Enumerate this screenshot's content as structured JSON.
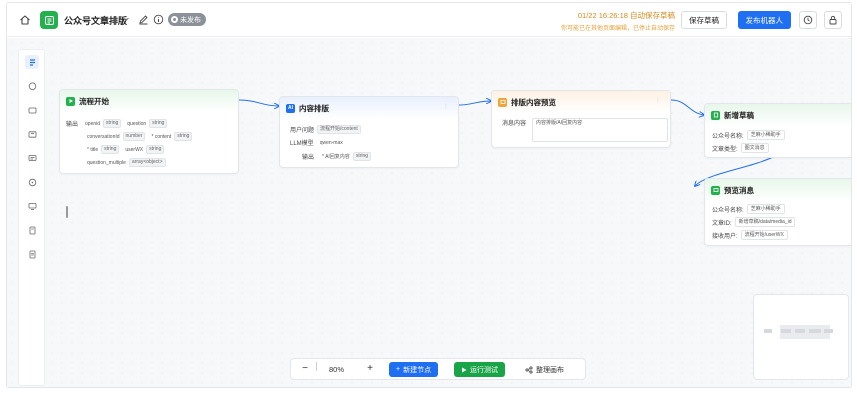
{
  "topbar": {
    "app_title": "公众号文章排版",
    "status": "未发布",
    "autosave_time": "01/22 16:26:18 自动保存草稿",
    "autosave_hint": "你可能已在其他页面编辑，已停止自动保存",
    "save_label": "保存草稿",
    "publish_label": "发布机器人",
    "brand_color": "#1f6ff2"
  },
  "nodes": {
    "start": {
      "title": "流程开始",
      "output_label": "输出",
      "fields": [
        {
          "name": "openid",
          "type": "string"
        },
        {
          "name": "question",
          "type": "string"
        },
        {
          "name": "conversationId",
          "type": "number"
        },
        {
          "name": "* content",
          "type": "string"
        },
        {
          "name": "* title",
          "type": "string"
        },
        {
          "name": "userWX",
          "type": "string"
        },
        {
          "name": "question_multiple",
          "type": "array<object>"
        }
      ]
    },
    "content": {
      "title": "内容排版",
      "question_label": "用户问题",
      "question_value": "流程开始/content",
      "model_label": "LLM模型",
      "model_value": "qwen-max",
      "output_label": "输出",
      "output_name": "* AI回复内容",
      "output_type": "string"
    },
    "preview": {
      "title": "排版内容预览",
      "message_label": "消息内容",
      "message_value": "内容排版/AI回复内容"
    },
    "draft": {
      "title": "新增草稿",
      "account_label": "公众号名称:",
      "account_value": "芝麻小稀助手",
      "type_label": "文章类型:",
      "type_value": "图文消息"
    },
    "preview_msg": {
      "title": "预览消息",
      "account_label": "公众号名称:",
      "account_value": "芝麻小稀助手",
      "article_label": "文章ID:",
      "article_value": "新增草稿/data/media_id",
      "user_label": "接收用户:",
      "user_value": "流程开始/userWX"
    }
  },
  "controls": {
    "zoom": "80%",
    "add_node_label": "新建节点",
    "run_label": "运行测试",
    "tidy_label": "整理画布"
  },
  "icons": {
    "home": "home-icon",
    "logo": "app-logo-icon",
    "edit": "edit-icon",
    "info": "info-icon",
    "history": "history-icon",
    "lock": "lock-icon"
  }
}
